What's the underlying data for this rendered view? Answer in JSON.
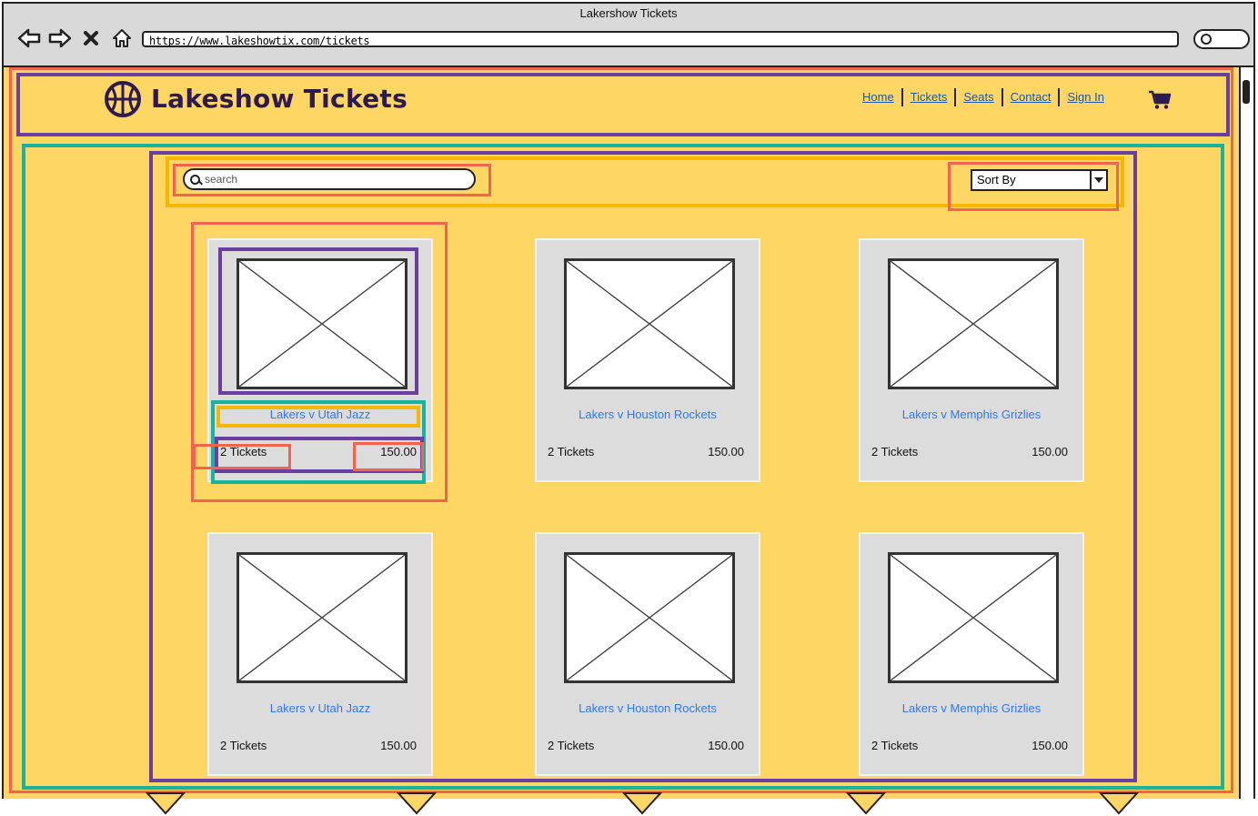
{
  "browser": {
    "window_title": "Lakershow Tickets",
    "url": "https://www.lakeshowtix.com/tickets"
  },
  "header": {
    "brand": "Lakeshow Tickets",
    "logo_icon": "basketball-icon",
    "nav": [
      "Home",
      "Tickets",
      "Seats",
      "Contact",
      "Sign In"
    ],
    "cart_icon": "shopping-cart-icon"
  },
  "toolbar": {
    "search_placeholder": "search",
    "sort_label": "Sort By"
  },
  "cards": [
    {
      "title": "Lakers v Utah Jazz",
      "tickets": "2 Tickets",
      "price": "150.00"
    },
    {
      "title": "Lakers v Houston Rockets",
      "tickets": "2 Tickets",
      "price": "150.00"
    },
    {
      "title": "Lakers v Memphis Grizlies",
      "tickets": "2 Tickets",
      "price": "150.00"
    },
    {
      "title": "Lakers v Utah Jazz",
      "tickets": "2 Tickets",
      "price": "150.00"
    },
    {
      "title": "Lakers v Houston Rockets",
      "tickets": "2 Tickets",
      "price": "150.00"
    },
    {
      "title": "Lakers v Memphis Grizlies",
      "tickets": "2 Tickets",
      "price": "150.00"
    }
  ],
  "colors": {
    "page_background": "#fdd663",
    "brand_text": "#2e1a52",
    "card_title": "#2f7ae5",
    "nav_link": "#1a5aa8",
    "annotation_red": "#f26450",
    "annotation_purple": "#6b3fa0",
    "annotation_teal": "#17b39c",
    "annotation_orange": "#f4b800"
  }
}
